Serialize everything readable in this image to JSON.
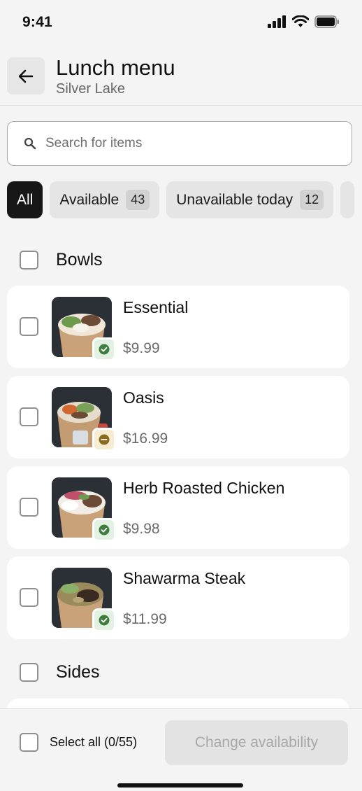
{
  "status_bar": {
    "time": "9:41"
  },
  "header": {
    "title": "Lunch menu",
    "subtitle": "Silver Lake"
  },
  "search": {
    "placeholder": "Search for items"
  },
  "filters": {
    "all_label": "All",
    "available_label": "Available",
    "available_count": "43",
    "unavailable_label": "Unavailable today",
    "unavailable_count": "12"
  },
  "sections": [
    {
      "label": "Bowls",
      "items": [
        {
          "name": "Essential",
          "price": "$9.99",
          "status": "available",
          "status_icon": "check-circle-icon"
        },
        {
          "name": "Oasis",
          "price": "$16.99",
          "status": "partial",
          "status_icon": "minus-circle-icon"
        },
        {
          "name": "Herb Roasted Chicken",
          "price": "$9.98",
          "status": "available",
          "status_icon": "check-circle-icon"
        },
        {
          "name": "Shawarma Steak",
          "price": "$11.99",
          "status": "available",
          "status_icon": "check-circle-icon"
        }
      ]
    },
    {
      "label": "Sides",
      "items": []
    }
  ],
  "bottom_bar": {
    "select_all_label": "Select all (0/55)",
    "change_button_label": "Change availability"
  },
  "colors": {
    "available_green": "#3f7d3f",
    "partial_brown": "#8a6a1e",
    "active_chip": "#171717"
  }
}
